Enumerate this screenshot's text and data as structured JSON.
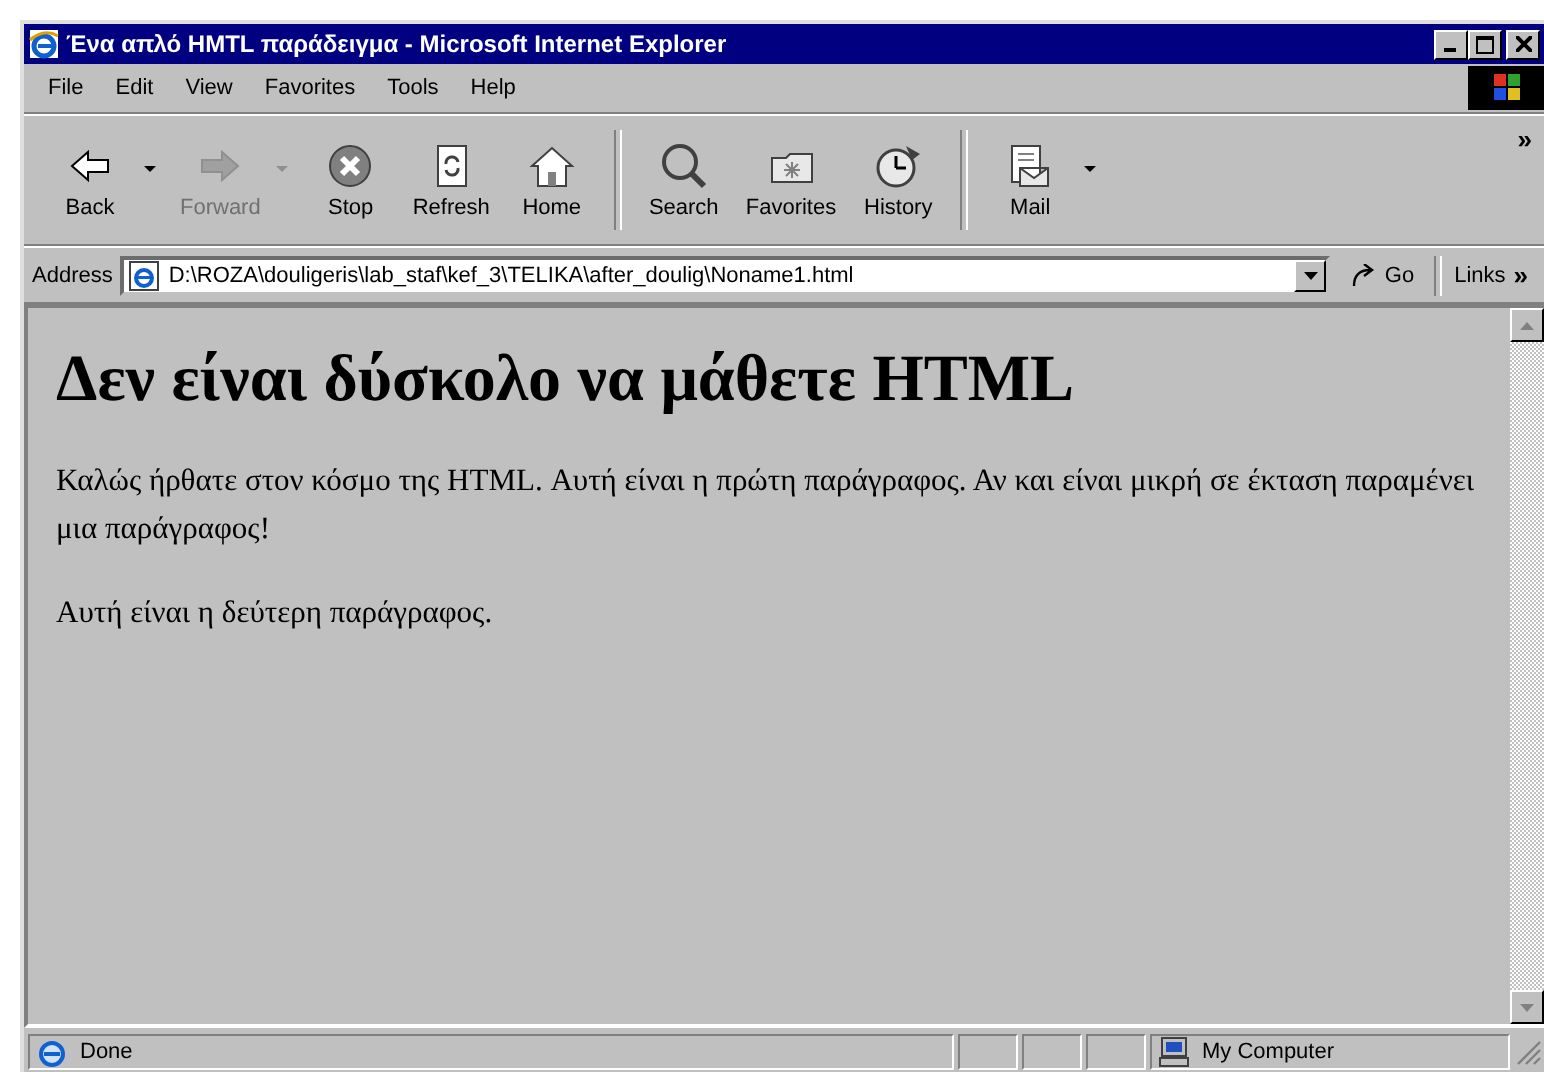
{
  "window": {
    "title": "Ένα απλό HMTL παράδειγμα - Microsoft Internet Explorer"
  },
  "menu": [
    "File",
    "Edit",
    "View",
    "Favorites",
    "Tools",
    "Help"
  ],
  "toolbar": {
    "groups": [
      [
        {
          "label": "Back",
          "disabled": false,
          "dropdown": true
        },
        {
          "label": "Forward",
          "disabled": true,
          "dropdown": true
        },
        {
          "label": "Stop",
          "disabled": false,
          "dropdown": false
        },
        {
          "label": "Refresh",
          "disabled": false,
          "dropdown": false
        },
        {
          "label": "Home",
          "disabled": false,
          "dropdown": false
        }
      ],
      [
        {
          "label": "Search",
          "disabled": false,
          "dropdown": false
        },
        {
          "label": "Favorites",
          "disabled": false,
          "dropdown": false
        },
        {
          "label": "History",
          "disabled": false,
          "dropdown": false
        }
      ],
      [
        {
          "label": "Mail",
          "disabled": false,
          "dropdown": true
        }
      ]
    ],
    "more": "»"
  },
  "address_bar": {
    "label": "Address",
    "value": "D:\\ROZA\\douligeris\\lab_staf\\kef_3\\TELIKA\\after_doulig\\Noname1.html",
    "go": "Go",
    "links": "Links",
    "links_more": "»"
  },
  "page": {
    "heading": "Δεν είναι δύσκολο να μάθετε HTML",
    "paragraphs": [
      "Καλώς ήρθατε στον κόσμο της HTML. Αυτή είναι η πρώτη παράγραφος. Αν και είναι μικρή σε έκταση παραμένει μια παράγραφος!",
      "Αυτή είναι η δεύτερη παράγραφος."
    ]
  },
  "status_bar": {
    "status": "Done",
    "zone": "My Computer"
  }
}
